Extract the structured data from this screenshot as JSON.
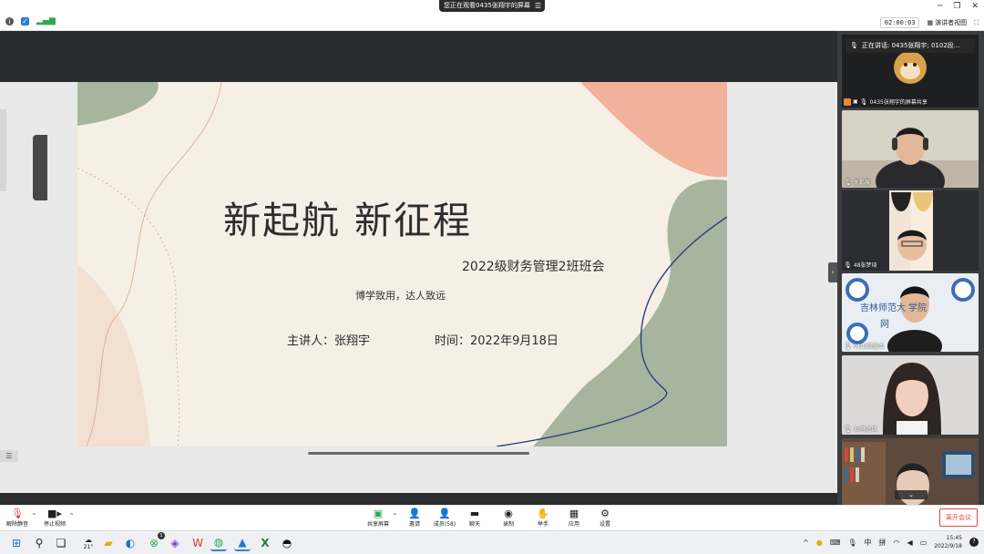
{
  "window": {
    "viewing_banner": "您正在观看0435张翔宇的屏幕",
    "timer": "02:00:03",
    "view_mode_label": "演讲者视图"
  },
  "slide": {
    "title": "新起航  新征程",
    "subtitle": "2022级财务管理2班班会",
    "motto": "博学致用，达人致远",
    "speaker": "主讲人：张翔宇",
    "time": "时间：2022年9月18日"
  },
  "participants": {
    "speaking_now": "正在讲话: 0435张翔宇; 0102段...",
    "tiles": [
      {
        "label": "0435张翔宇的屏幕共享"
      },
      {
        "label": "关鹏展"
      },
      {
        "label": "48张梦琦"
      },
      {
        "label": "0102段鑫韦"
      },
      {
        "label": "30马远钰"
      },
      {
        "label": ""
      }
    ],
    "school_sign_text": "吉林师范大    学院",
    "school_sign_text2": "网"
  },
  "toolbar": {
    "unmute": "解除静音",
    "stop_video": "停止视频",
    "share_screen": "共享屏幕",
    "invite": "邀请",
    "members": "成员(58)",
    "chat": "聊天",
    "record": "录制",
    "raise_hand": "举手",
    "apps": "应用",
    "settings": "设置",
    "leave": "离开会议"
  },
  "taskbar": {
    "weather": "21°",
    "ime_lang": "中",
    "ime_mode": "拼",
    "time": "15:45",
    "date": "2022/9/18",
    "notification_badge": "1"
  },
  "colors": {
    "slide_bg": "#f6efe5",
    "sage": "#a7b59e",
    "peach": "#f0b29b",
    "leave_red": "#e04848"
  }
}
